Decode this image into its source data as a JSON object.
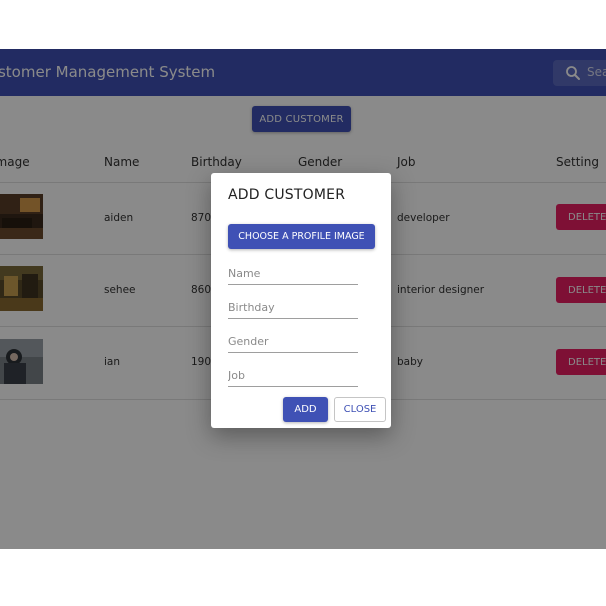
{
  "appbar": {
    "title": "Customer Management System",
    "search_placeholder": "Search"
  },
  "toolbar": {
    "add_customer_label": "ADD CUSTOMER"
  },
  "table": {
    "headers": [
      "Image",
      "Name",
      "Birthday",
      "Gender",
      "Job",
      "Setting"
    ],
    "rows": [
      {
        "name": "aiden",
        "birthday": "8708",
        "job": "developer",
        "action": "DELETE"
      },
      {
        "name": "sehee",
        "birthday": "8602",
        "job": "interior designer",
        "action": "DELETE"
      },
      {
        "name": "ian",
        "birthday": "1902",
        "job": "baby",
        "action": "DELETE"
      }
    ]
  },
  "dialog": {
    "title": "ADD CUSTOMER",
    "choose_image_label": "CHOOSE A PROFILE IMAGE",
    "fields": {
      "name_placeholder": "Name",
      "birthday_placeholder": "Birthday",
      "gender_placeholder": "Gender",
      "job_placeholder": "Job"
    },
    "add_label": "ADD",
    "close_label": "CLOSE"
  },
  "colors": {
    "primary": "#3f51b5",
    "danger": "#e91e63",
    "backdrop": "rgba(0,0,0,0.46)"
  }
}
